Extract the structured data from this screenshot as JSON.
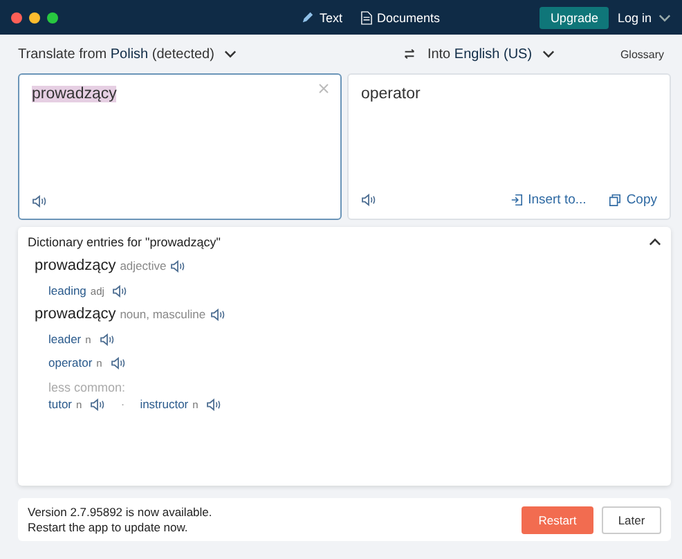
{
  "title_bar": {
    "tabs": [
      {
        "kind": "text",
        "label": "Text"
      },
      {
        "kind": "documents",
        "label": "Documents"
      }
    ],
    "upgrade": "Upgrade",
    "login": "Log in"
  },
  "toolbar": {
    "source_language": "Translate from **Polish** (detected)",
    "target_language": "Into **English (US)**",
    "glossary": "Glossary"
  },
  "source": {
    "value": "prowadzący",
    "highlighted": true
  },
  "target": {
    "value": "operator",
    "actions": [
      {
        "kind": "insert",
        "label": "Insert to..."
      },
      {
        "kind": "copy",
        "label": "Copy"
      }
    ]
  },
  "dictionary": {
    "title": "Dictionary entries for \"prowadzący\"",
    "expanded": true,
    "entries": [
      {
        "headword": "prowadzący",
        "pos": "adjective",
        "rows": [
          {
            "items": [
              {
                "word": "leading",
                "pos": "adj"
              }
            ]
          }
        ]
      },
      {
        "headword": "prowadzący",
        "pos": "noun, masculine",
        "rows": [
          {
            "items": [
              {
                "word": "leader",
                "pos": "n"
              }
            ]
          },
          {
            "items": [
              {
                "word": "operator",
                "pos": "n"
              }
            ]
          },
          {
            "label": "less common:",
            "separator": "·",
            "items": [
              {
                "word": "tutor",
                "pos": "n"
              },
              {
                "word": "instructor",
                "pos": "n"
              }
            ]
          }
        ]
      }
    ]
  },
  "update": {
    "lines": [
      "Version 2.7.95892 is now available.",
      "Restart the app to update now."
    ],
    "buttons": [
      {
        "kind": "primary",
        "label": "Restart"
      },
      {
        "kind": "secondary",
        "label": "Later"
      }
    ]
  }
}
